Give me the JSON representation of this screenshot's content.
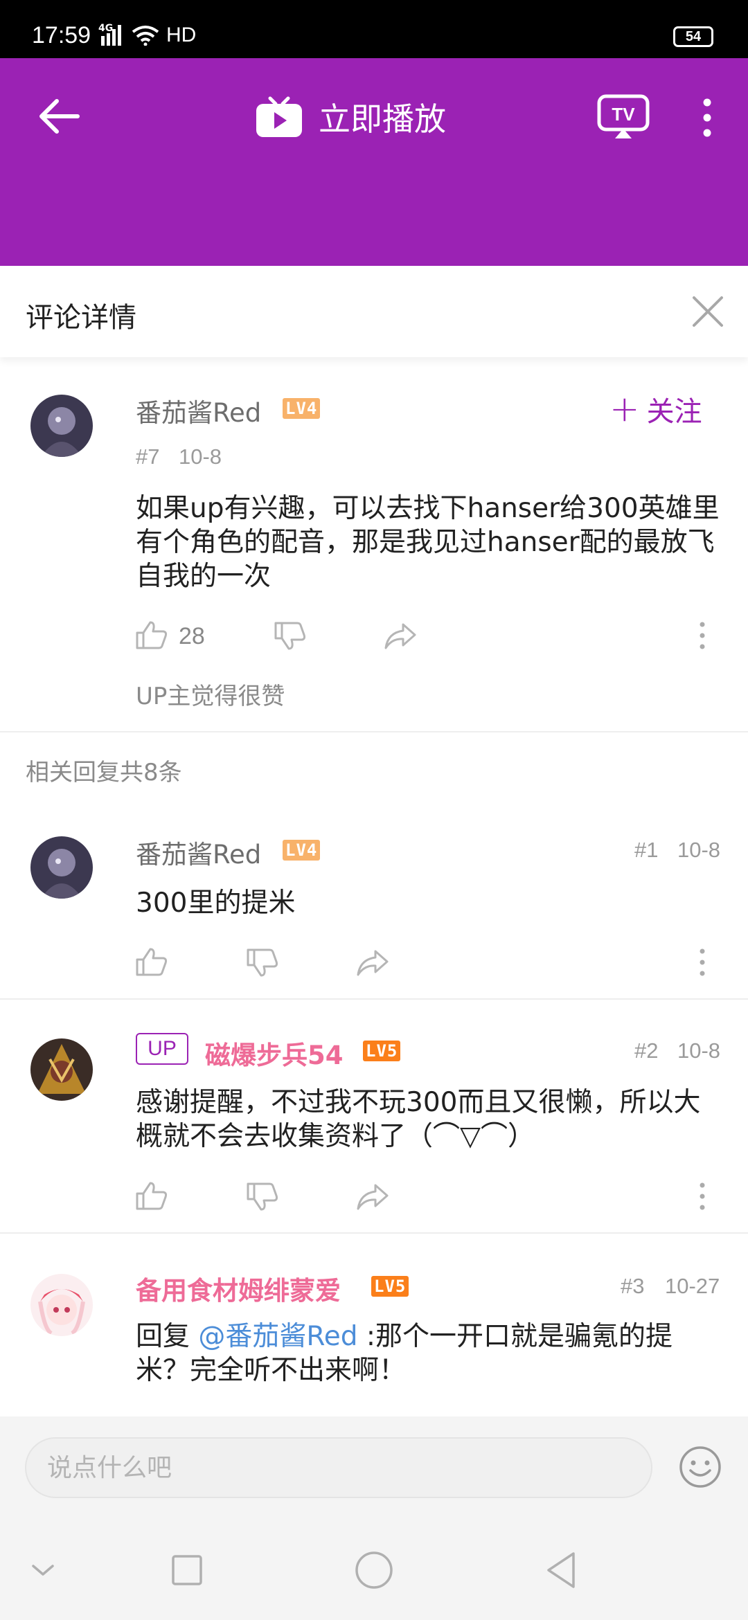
{
  "status_bar": {
    "time": "17:59",
    "network": "4G",
    "hd": "HD",
    "battery": "54"
  },
  "header": {
    "title": "立即播放"
  },
  "detail": {
    "title": "评论详情"
  },
  "main_comment": {
    "username": "番茄酱Red",
    "level": "LV4",
    "follow_label": "关注",
    "floor": "#7",
    "date": "10-8",
    "text": "如果up有兴趣，可以去找下hanser给300英雄里有个角色的配音，那是我见过hanser配的最放飞自我的一次",
    "likes": "28",
    "up_liked": "UP主觉得很赞"
  },
  "replies_header": "相关回复共8条",
  "replies": [
    {
      "username": "番茄酱Red",
      "level": "LV4",
      "floor": "#1",
      "date": "10-8",
      "text": "300里的提米"
    },
    {
      "badge": "UP",
      "username": "磁爆步兵54",
      "level": "LV5",
      "floor": "#2",
      "date": "10-8",
      "text": "感谢提醒，不过我不玩300而且又很懒，所以大概就不会去收集资料了（⌒▽⌒）"
    },
    {
      "username": "备用食材姆绯蒙爱",
      "level": "LV5",
      "floor": "#3",
      "date": "10-27",
      "text_prefix": "回复 ",
      "mention": "@番茄酱Red",
      "text_suffix": " :那个一开口就是骗氪的提米？完全听不出来啊！"
    }
  ],
  "input": {
    "placeholder": "说点什么吧"
  },
  "colors": {
    "brand": "#9b22b4",
    "pink_name": "#ee6b97",
    "mention": "#4c8dd8"
  }
}
